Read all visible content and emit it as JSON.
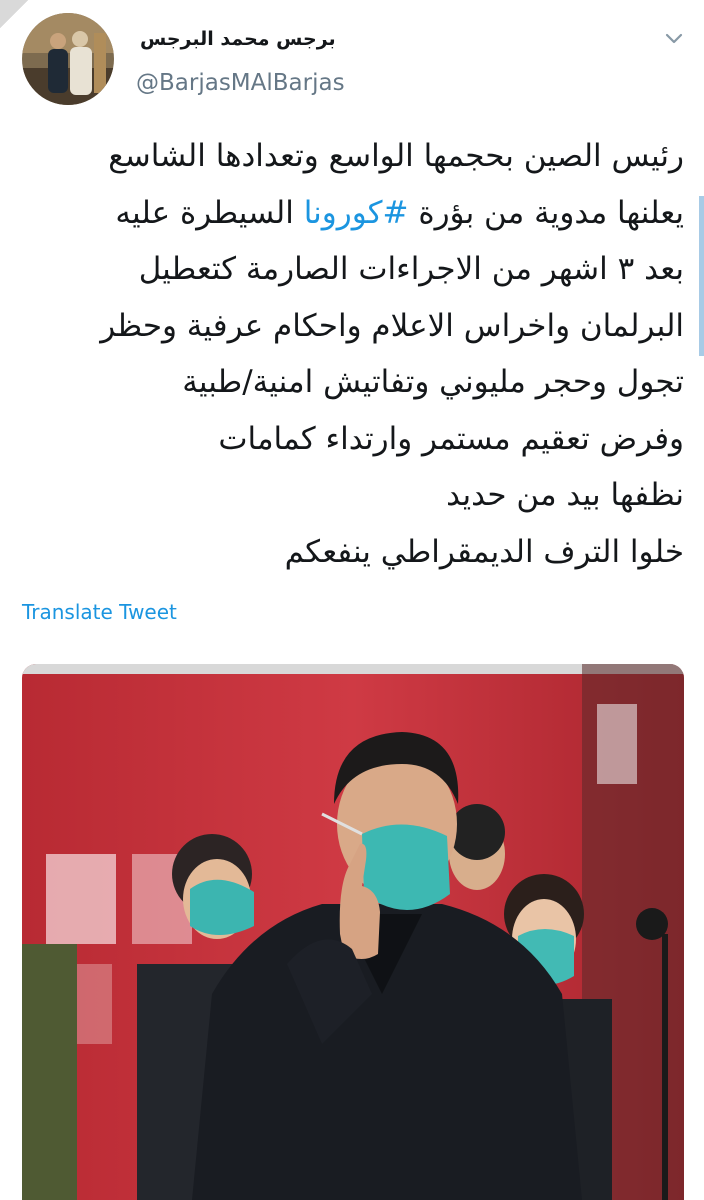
{
  "tweet": {
    "display_name": "برجس محمد البرجس",
    "handle": "@BarjasMAlBarjas",
    "text_lines": [
      "رئيس الصين بحجمها الواسع وتعدادها الشاسع",
      "السيطرة عليه",
      "بعد ٣ اشهر من الاجراءات الصارمة كتعطيل",
      "البرلمان واخراس الاعلام واحكام عرفية وحظر",
      "تجول وحجر مليوني وتفاتيش امنية/طبية",
      "وفرض تعقيم مستمر وارتداء كمامات",
      "نظفها بيد من حديد",
      "خلوا الترف الديمقراطي ينفعكم"
    ],
    "line2_prefix": "يعلنها مدوية من بؤرة",
    "hashtag": "#كورونا",
    "translate_label": "Translate Tweet"
  },
  "icons": {
    "menu": "chevron-down-icon",
    "avatar": "avatar-photo",
    "media": "tweet-photo-man-in-mask"
  },
  "colors": {
    "link": "#1b95e0",
    "secondary_text": "#657786",
    "media_background": "#c8303b"
  }
}
